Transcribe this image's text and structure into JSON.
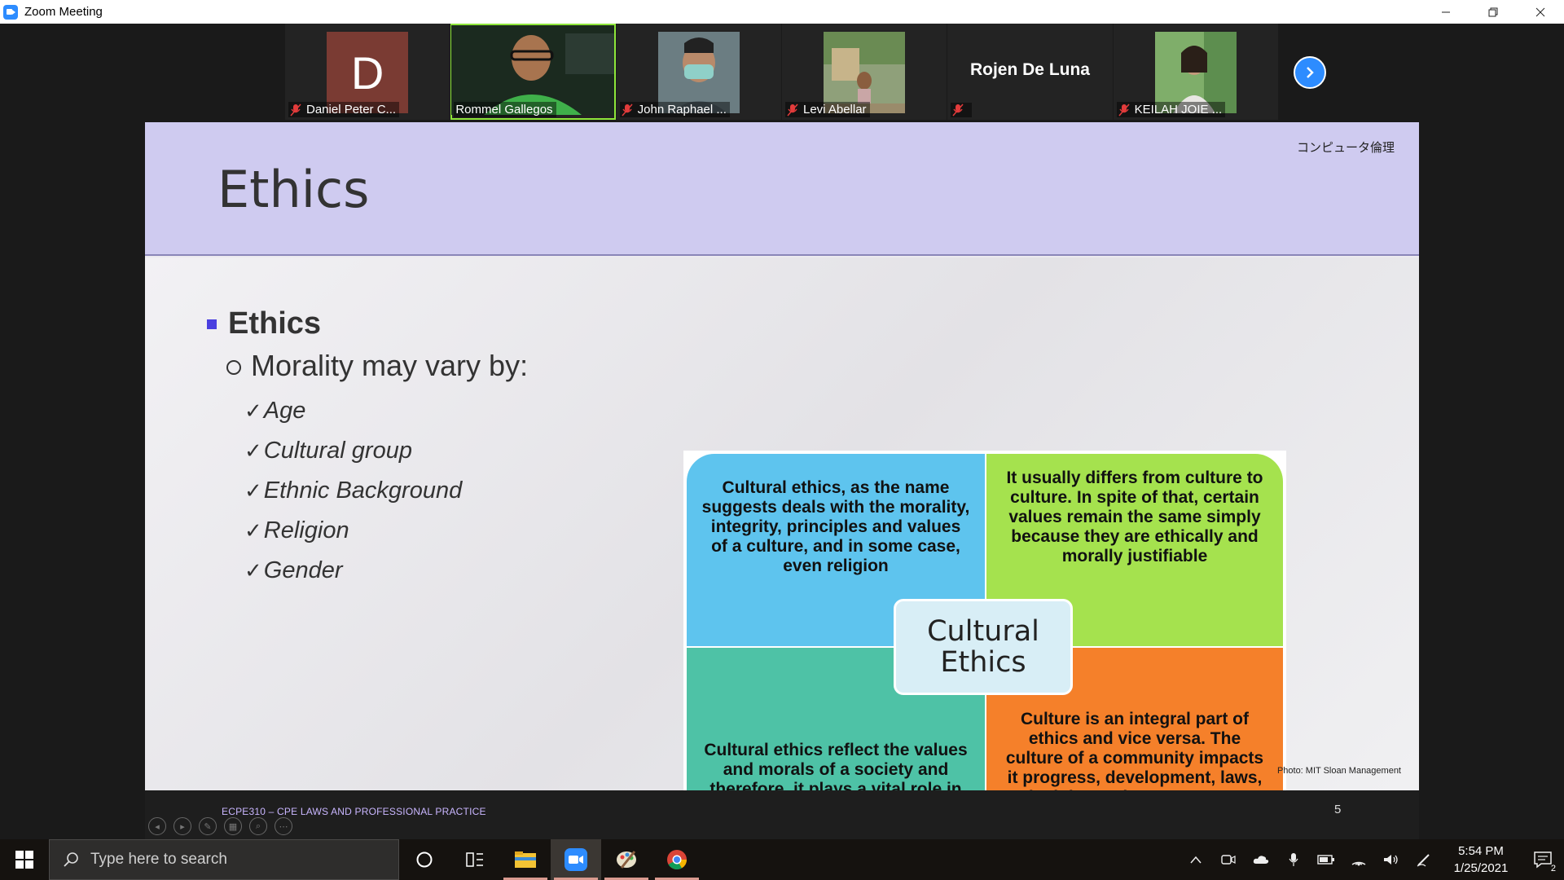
{
  "window": {
    "title": "Zoom Meeting",
    "controls": [
      "minimize",
      "restore",
      "close"
    ]
  },
  "participants": [
    {
      "name": "Daniel Peter C...",
      "muted": true,
      "video": "avatar",
      "initial": "D"
    },
    {
      "name": "Rommel Gallegos",
      "muted": false,
      "video": "camera",
      "active_speaker": true
    },
    {
      "name": "John Raphael ...",
      "muted": true,
      "video": "camera"
    },
    {
      "name": "Levi Abellar",
      "muted": true,
      "video": "camera"
    },
    {
      "name": "Rojen De Luna",
      "muted": true,
      "video": "off"
    },
    {
      "name": "KEILAH JOIE ...",
      "muted": true,
      "video": "camera"
    }
  ],
  "slide": {
    "header_title": "Ethics",
    "corner_label": "コンピュータ倫理",
    "bullet_main": "Ethics",
    "bullet_sub": "Morality may vary by:",
    "checks": [
      "Age",
      "Cultural group",
      "Ethnic Background",
      "Religion",
      "Gender"
    ],
    "diagram": {
      "center": "Cultural Ethics",
      "q1": "Cultural ethics, as the name suggests deals with the morality, integrity, principles and values of a culture, and in some case, even religion",
      "q2": "It usually differs from culture to culture. In spite of that, certain values remain the same simply because they are ethically and morally justifiable",
      "q3": "Cultural ethics reflect the values and morals of a society and therefore, it plays a vital role in the governance of that society.",
      "q4": "Culture is an integral part of ethics and vice versa. The culture of a community impacts it progress, development, laws, principles and to some extent, its policies",
      "colors": {
        "q1": "#5ec4ee",
        "q2": "#a5e24e",
        "q3": "#4ec2a6",
        "q4": "#f5802a"
      }
    },
    "photo_credit": "Photo: MIT Sloan Management",
    "footer_course": "ECPE310 – CPE LAWS AND PROFESSIONAL PRACTICE",
    "page_number": "5"
  },
  "taskbar": {
    "search_placeholder": "Type here to search",
    "time": "5:54 PM",
    "date": "1/25/2021",
    "notification_count": "2",
    "apps": [
      "cortana-icon",
      "task-view-icon",
      "file-explorer-icon",
      "zoom-icon",
      "paint-icon",
      "chrome-icon"
    ]
  },
  "colors": {
    "zoom_blue": "#2d8cff",
    "active_speaker": "#8ee63a",
    "header_lavender": "#cfcbf0"
  }
}
